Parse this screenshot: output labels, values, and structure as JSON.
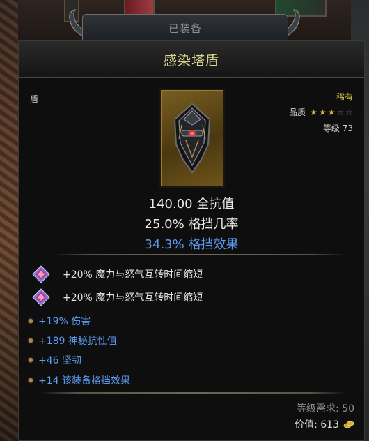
{
  "header": {
    "tab_label": "已装备"
  },
  "item": {
    "name": "感染塔盾",
    "type": "盾",
    "rarity": "稀有",
    "quality_label": "品质",
    "quality_stars": 3,
    "quality_max": 5,
    "level_text": "等级 73",
    "icon": "shield-icon"
  },
  "stats": {
    "resist": "140.00 全抗值",
    "block_chance": "25.0% 格挡几率",
    "block_effect": "34.3% 格挡效果"
  },
  "sockets": [
    {
      "text": "+20% 魔力与怒气互转时间缩短",
      "icon": "gem-icon"
    },
    {
      "text": "+20% 魔力与怒气互转时间缩短",
      "icon": "gem-icon"
    }
  ],
  "affixes": [
    {
      "text": "+19% 伤害"
    },
    {
      "text": "+189 神秘抗性值"
    },
    {
      "text": "+46 坚韧"
    },
    {
      "text": "+14 该装备格挡效果"
    }
  ],
  "footer": {
    "requirement": "等级需求: 50",
    "value": "价值: 613",
    "coin_icon": "gold-coin-icon"
  },
  "colors": {
    "title": "#d8d68a",
    "rarity": "#d2c64b",
    "magic_blue": "#5a9cf0",
    "star_gold": "#d6b23c"
  }
}
